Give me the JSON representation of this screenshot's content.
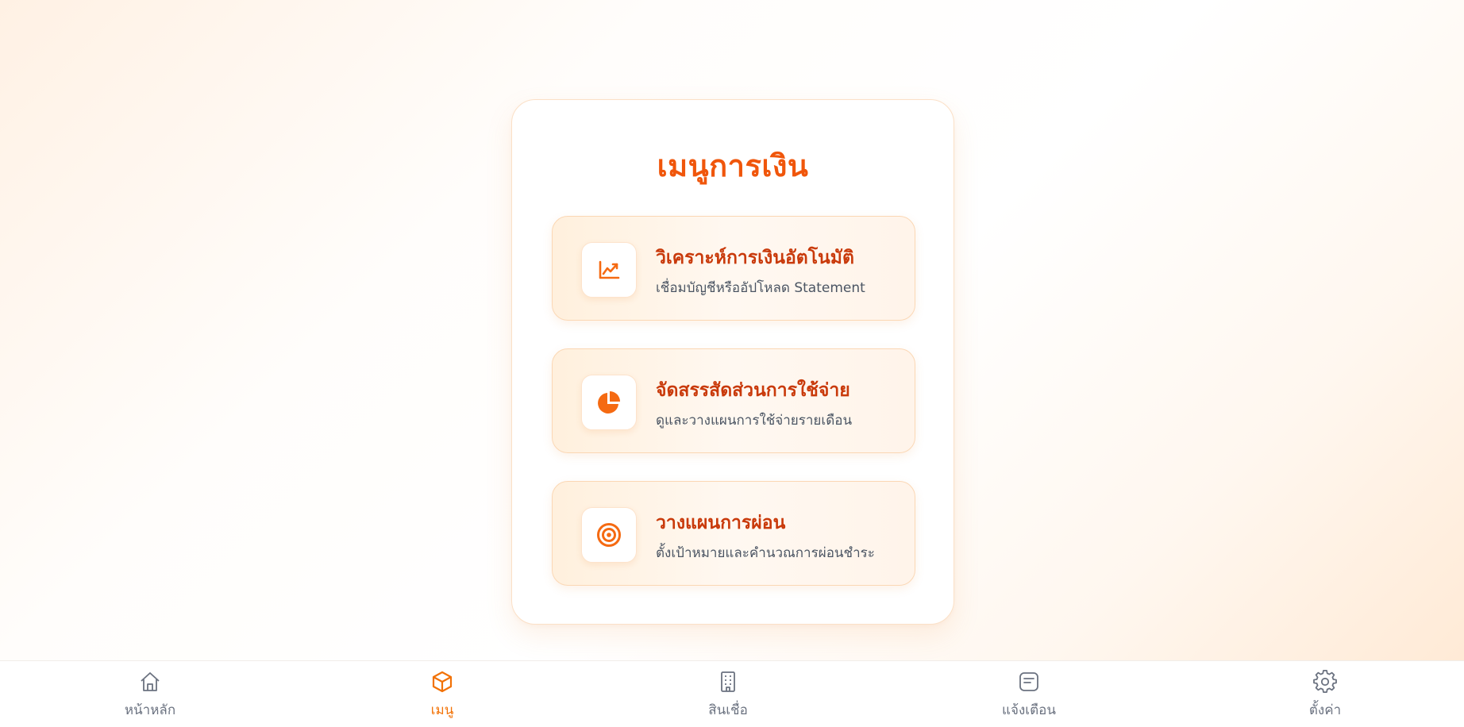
{
  "card": {
    "title": "เมนูการเงิน"
  },
  "menu_items": [
    {
      "title": "วิเคราะห์การเงินอัตโนมัติ",
      "subtitle": "เชื่อมบัญชีหรืออัปโหลด Statement",
      "icon": "chart-line-icon"
    },
    {
      "title": "จัดสรรสัดส่วนการใช้จ่าย",
      "subtitle": "ดูและวางแผนการใช้จ่ายรายเดือน",
      "icon": "pie-chart-icon"
    },
    {
      "title": "วางแผนการผ่อน",
      "subtitle": "ตั้งเป้าหมายและคำนวณการผ่อนชำระ",
      "icon": "target-icon"
    }
  ],
  "bottom_nav": {
    "items": [
      {
        "label": "หน้าหลัก",
        "icon": "home-icon",
        "active": false
      },
      {
        "label": "เมนู",
        "icon": "box-icon",
        "active": true
      },
      {
        "label": "สินเชื่อ",
        "icon": "building-icon",
        "active": false
      },
      {
        "label": "แจ้งเตือน",
        "icon": "message-square-icon",
        "active": false
      },
      {
        "label": "ตั้งค่า",
        "icon": "gear-icon",
        "active": false
      }
    ]
  },
  "colors": {
    "accent": "#f0560b",
    "item_title": "#c93a0b",
    "icon": "#f56a12",
    "nav_active": "#f27207",
    "nav_inactive": "#6b7280"
  }
}
